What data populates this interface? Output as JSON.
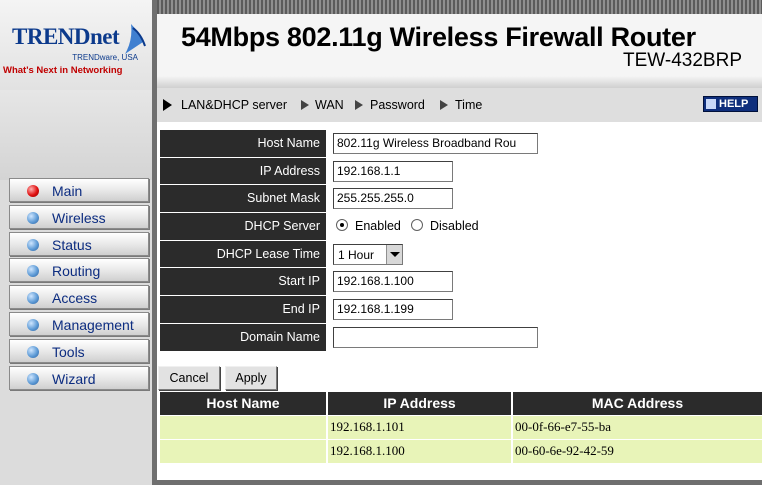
{
  "brand": {
    "logo_text": "TRENDnet",
    "sub_text": "TRENDware, USA",
    "tagline": "What's Next in Networking"
  },
  "header": {
    "title": "54Mbps 802.11g Wireless Firewall Router",
    "model": "TEW-432BRP"
  },
  "nav": {
    "crumbs": [
      "LAN&DHCP server",
      "WAN",
      "Password",
      "Time"
    ],
    "help_label": "HELP"
  },
  "menu": {
    "items": [
      "Main",
      "Wireless",
      "Status",
      "Routing",
      "Access",
      "Management",
      "Tools",
      "Wizard"
    ],
    "active": "Main"
  },
  "form": {
    "host_name": {
      "label": "Host Name",
      "value": "802.11g Wireless Broadband Rou"
    },
    "ip_address": {
      "label": "IP Address",
      "value": "192.168.1.1"
    },
    "subnet_mask": {
      "label": "Subnet Mask",
      "value": "255.255.255.0"
    },
    "dhcp_server": {
      "label": "DHCP Server",
      "enabled_label": "Enabled",
      "disabled_label": "Disabled",
      "selected": "Enabled"
    },
    "lease_time": {
      "label": "DHCP Lease Time",
      "value": "1 Hour"
    },
    "start_ip": {
      "label": "Start IP",
      "value": "192.168.1.100"
    },
    "end_ip": {
      "label": "End IP",
      "value": "192.168.1.199"
    },
    "domain_name": {
      "label": "Domain Name",
      "value": ""
    }
  },
  "buttons": {
    "cancel": "Cancel",
    "apply": "Apply"
  },
  "clients": {
    "headers": [
      "Host Name",
      "IP Address",
      "MAC Address"
    ],
    "rows": [
      {
        "host": "",
        "ip": "192.168.1.101",
        "mac": "00-0f-66-e7-55-ba"
      },
      {
        "host": "",
        "ip": "192.168.1.100",
        "mac": "00-60-6e-92-42-59"
      }
    ]
  },
  "colors": {
    "brand_blue": "#0c3a8c",
    "tagline_red": "#c00000",
    "label_bg": "#2b2b2b",
    "row_bg": "#e8f4b8",
    "help_bg": "#0e2e7c"
  }
}
